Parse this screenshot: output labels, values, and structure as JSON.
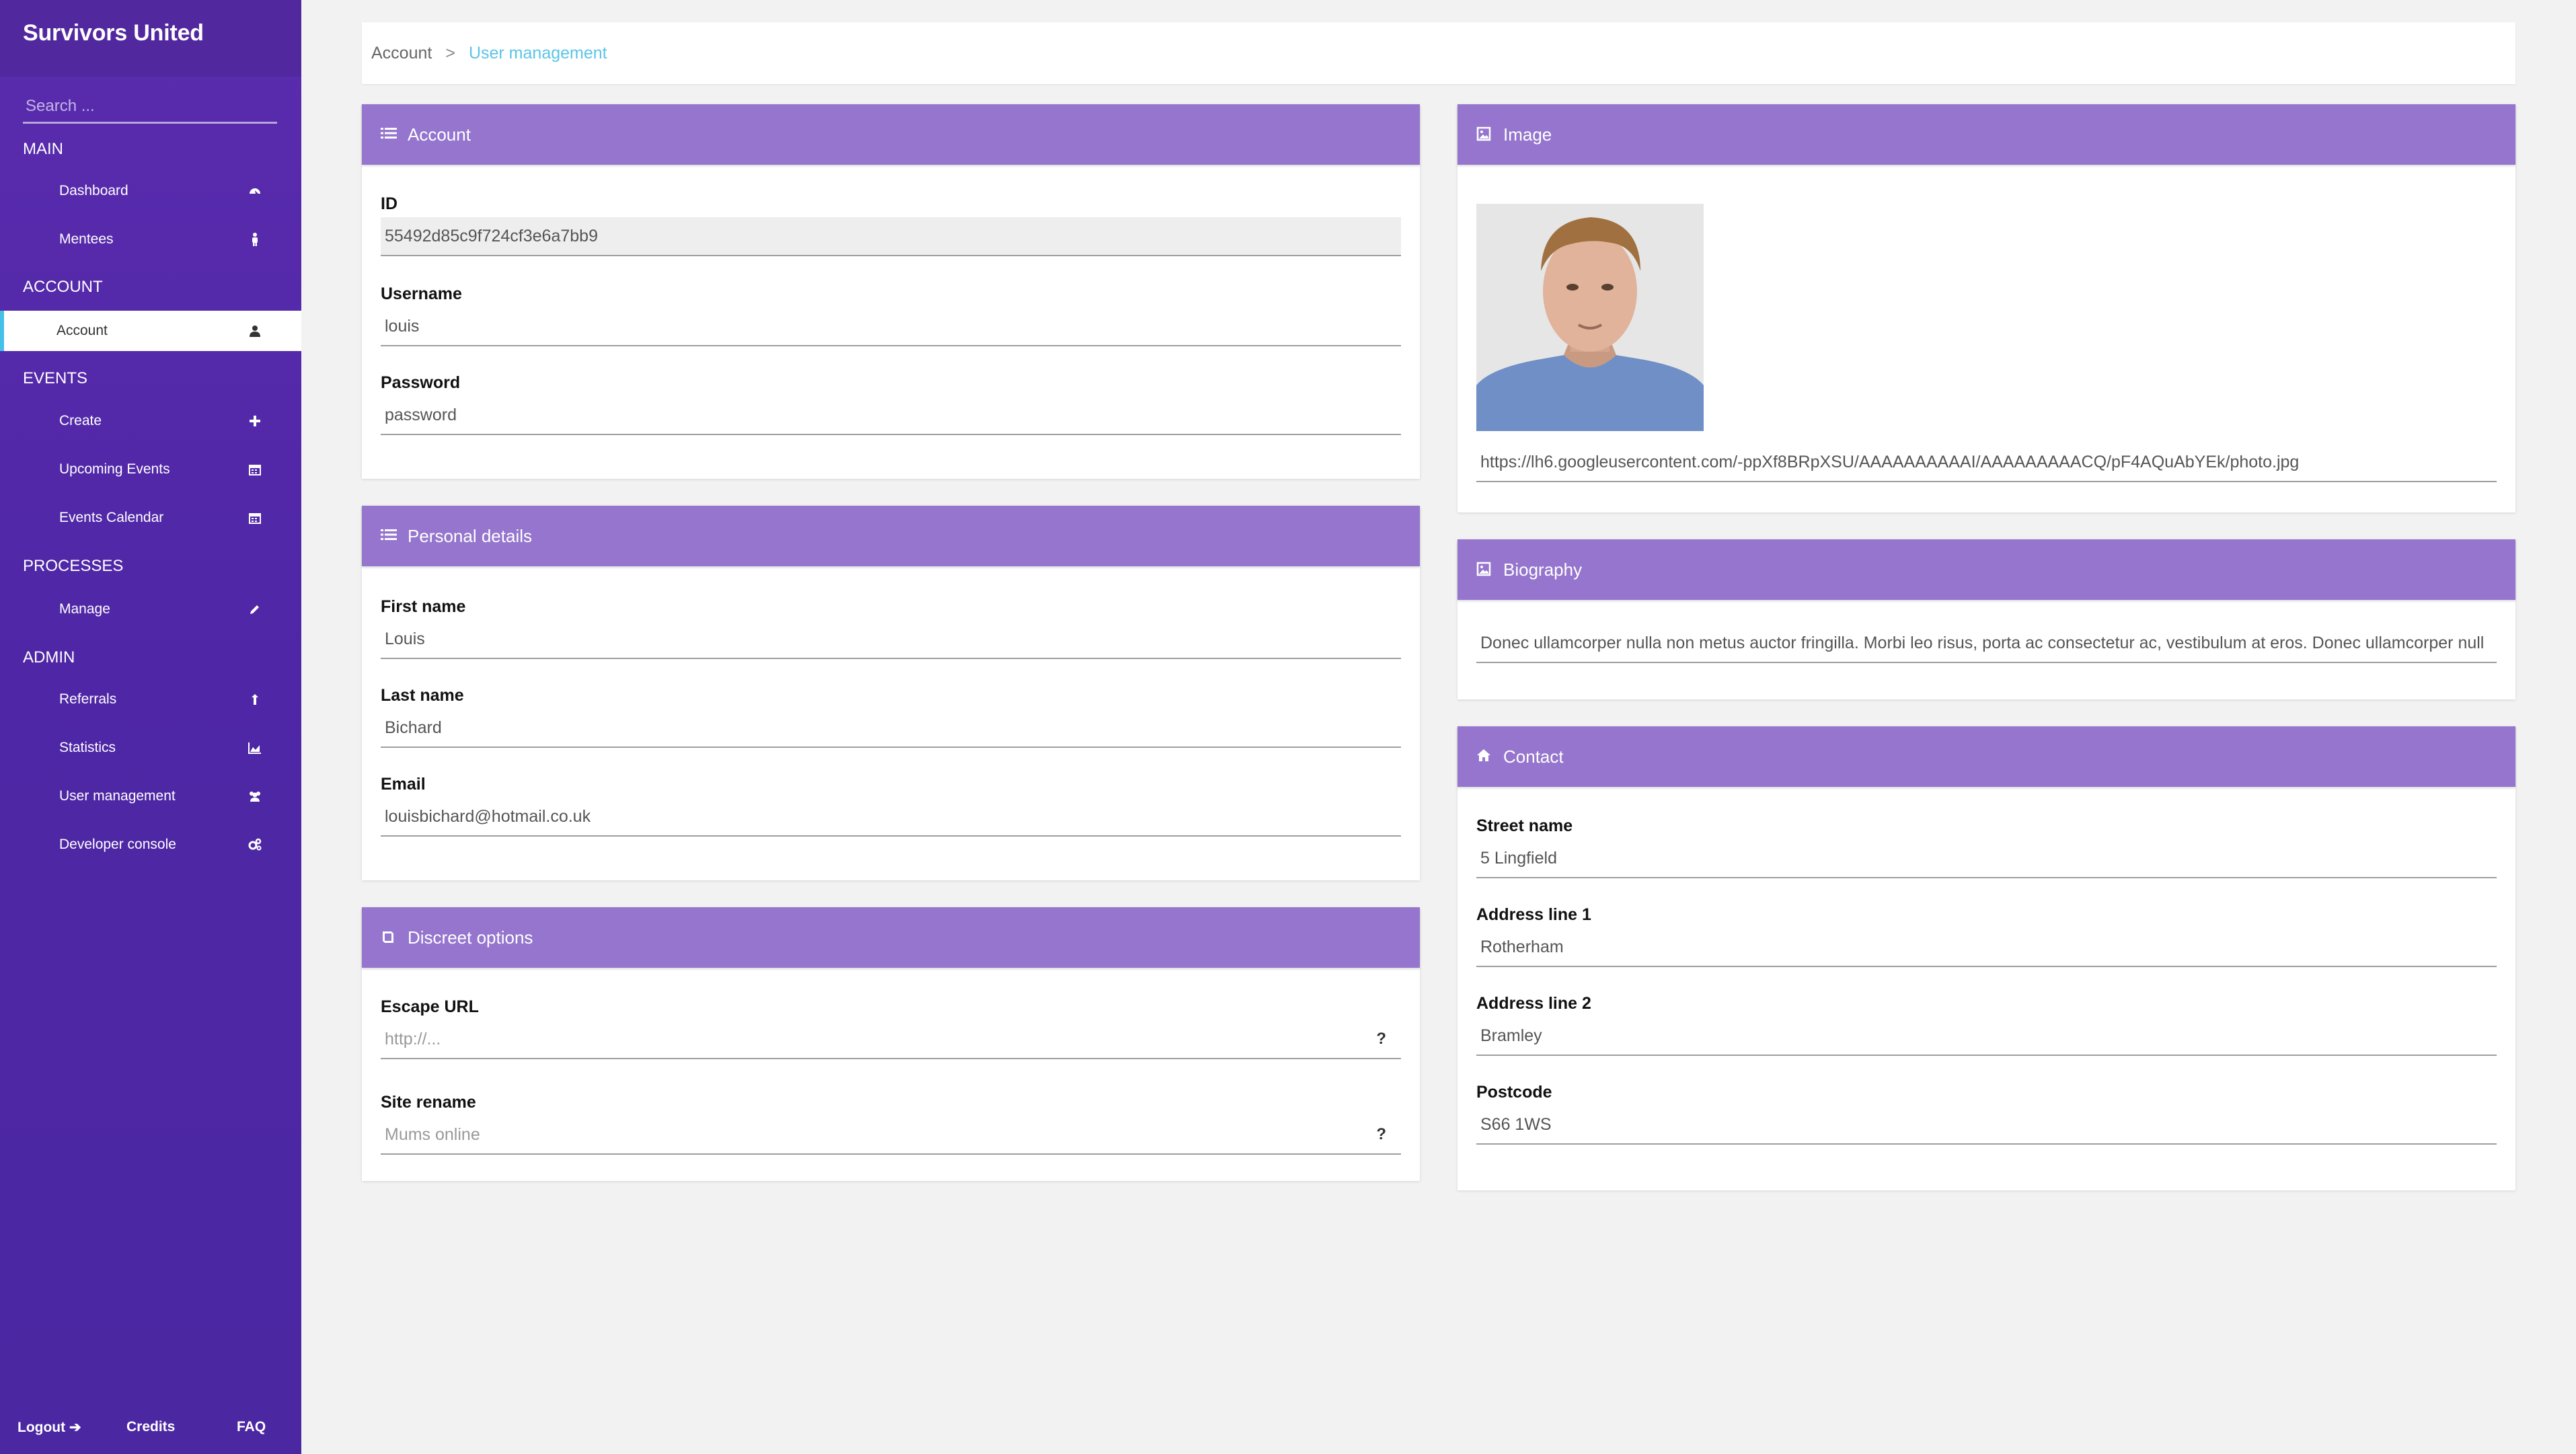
{
  "sidebar": {
    "brand": "Survivors United",
    "search_placeholder": "Search ...",
    "sections": {
      "main": "MAIN",
      "account": "ACCOUNT",
      "events": "EVENTS",
      "processes": "PROCESSES",
      "admin": "ADMIN"
    },
    "items": {
      "dashboard": "Dashboard",
      "mentees": "Mentees",
      "account": "Account",
      "create": "Create",
      "upcoming_events": "Upcoming Events",
      "events_calendar": "Events Calendar",
      "manage": "Manage",
      "referrals": "Referrals",
      "statistics": "Statistics",
      "user_management": "User management",
      "developer_console": "Developer console"
    },
    "footer": {
      "logout": "Logout ➔",
      "credits": "Credits",
      "faq": "FAQ"
    }
  },
  "breadcrumb": {
    "parent": "Account",
    "separator": ">",
    "current": "User management"
  },
  "account_panel": {
    "title": "Account",
    "id_label": "ID",
    "id_value": "55492d85c9f724cf3e6a7bb9",
    "username_label": "Username",
    "username_value": "louis",
    "password_label": "Password",
    "password_value": "password"
  },
  "personal_panel": {
    "title": "Personal details",
    "first_name_label": "First name",
    "first_name_value": "Louis",
    "last_name_label": "Last name",
    "last_name_value": "Bichard",
    "email_label": "Email",
    "email_value": "louisbichard@hotmail.co.uk"
  },
  "discreet_panel": {
    "title": "Discreet options",
    "escape_label": "Escape URL",
    "escape_placeholder": "http://...",
    "rename_label": "Site rename",
    "rename_placeholder": "Mums online",
    "help": "?"
  },
  "image_panel": {
    "title": "Image",
    "url_value": "https://lh6.googleusercontent.com/-ppXf8BRpXSU/AAAAAAAAAAI/AAAAAAAAACQ/pF4AQuAbYEk/photo.jpg"
  },
  "biography_panel": {
    "title": "Biography",
    "text_value": "Donec ullamcorper nulla non metus auctor fringilla. Morbi leo risus, porta ac consectetur ac, vestibulum at eros. Donec ullamcorper null"
  },
  "contact_panel": {
    "title": "Contact",
    "street_label": "Street name",
    "street_value": "5 Lingfield",
    "addr1_label": "Address line 1",
    "addr1_value": "Rotherham",
    "addr2_label": "Address line 2",
    "addr2_value": "Bramley",
    "postcode_label": "Postcode",
    "postcode_value": "S66 1WS"
  },
  "colors": {
    "sidebar": "#4f27a6",
    "panel_header": "#9575cd",
    "accent_link": "#5bc4e8",
    "background": "#f2f2f2"
  }
}
